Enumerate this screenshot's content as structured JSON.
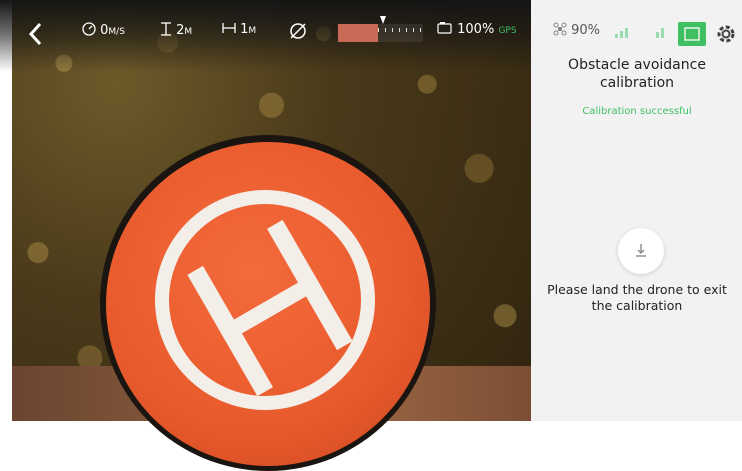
{
  "telemetry": {
    "speed_value": "0",
    "speed_unit": "M/S",
    "altitude_value": "2",
    "altitude_unit": "M",
    "distance_value": "1",
    "distance_unit": "M",
    "camera_battery": "100%",
    "gps_label": "GPS",
    "drone_battery": "90%"
  },
  "panel": {
    "title": "Obstacle avoidance calibration",
    "status": "Calibration successful",
    "instruction": "Please land the drone to exit the calibration"
  },
  "colors": {
    "status_green": "#3fbf62",
    "panel_bg": "#f2f2f2"
  }
}
